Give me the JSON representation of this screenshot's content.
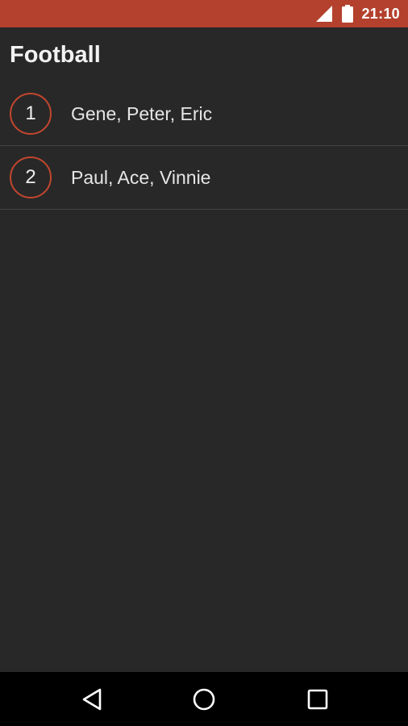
{
  "status_bar": {
    "time": "21:10",
    "signal_icon": "cellular-signal-icon",
    "battery_icon": "battery-full-icon",
    "background_color": "#b3412d"
  },
  "page": {
    "title": "Football"
  },
  "teams": [
    {
      "number": "1",
      "players": "Gene, Peter, Eric"
    },
    {
      "number": "2",
      "players": "Paul, Ace, Vinnie"
    }
  ],
  "theme": {
    "background": "#282828",
    "accent": "#c2462e",
    "text": "#e6e6e6"
  },
  "nav_bar": {
    "back_icon": "back-triangle-icon",
    "home_icon": "home-circle-icon",
    "recents_icon": "recents-square-icon"
  }
}
